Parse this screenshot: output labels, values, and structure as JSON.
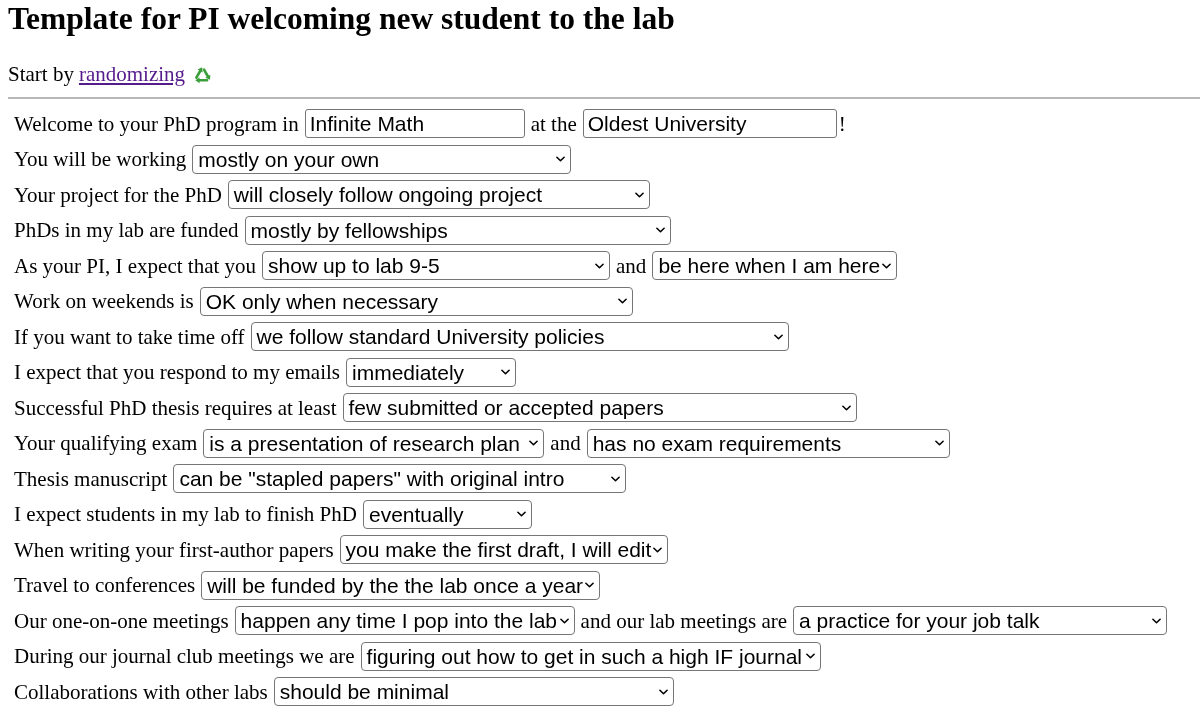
{
  "title": "Template for PI welcoming new student to the lab",
  "intro": {
    "text": "Start by",
    "link": "randomizing"
  },
  "rows": [
    {
      "parts": [
        {
          "kind": "text",
          "text": "Welcome to your PhD program in"
        },
        {
          "kind": "input",
          "value": "Infinite Math"
        },
        {
          "kind": "text",
          "text": "at the"
        },
        {
          "kind": "input",
          "value": "Oldest University",
          "suffix": "!"
        }
      ]
    },
    {
      "parts": [
        {
          "kind": "text",
          "text": "You will be working"
        },
        {
          "kind": "dropdown",
          "value": "mostly on your own"
        }
      ]
    },
    {
      "parts": [
        {
          "kind": "text",
          "text": "Your project for the PhD"
        },
        {
          "kind": "dropdown",
          "value": "will closely follow ongoing project"
        }
      ]
    },
    {
      "parts": [
        {
          "kind": "text",
          "text": "PhDs in my lab are funded"
        },
        {
          "kind": "dropdown",
          "value": "mostly by fellowships"
        }
      ]
    },
    {
      "parts": [
        {
          "kind": "text",
          "text": "As your PI, I expect that you"
        },
        {
          "kind": "dropdown",
          "value": "show up to lab 9-5"
        },
        {
          "kind": "text",
          "text": "and"
        },
        {
          "kind": "dropdown",
          "value": "be here when I am here"
        }
      ]
    },
    {
      "parts": [
        {
          "kind": "text",
          "text": "Work on weekends is"
        },
        {
          "kind": "dropdown",
          "value": "OK only when necessary"
        }
      ]
    },
    {
      "parts": [
        {
          "kind": "text",
          "text": "If you want to take time off"
        },
        {
          "kind": "dropdown",
          "value": "we follow standard University policies"
        }
      ]
    },
    {
      "parts": [
        {
          "kind": "text",
          "text": "I expect that you respond to my emails"
        },
        {
          "kind": "dropdown",
          "value": "immediately"
        }
      ]
    },
    {
      "parts": [
        {
          "kind": "text",
          "text": "Successful PhD thesis requires at least"
        },
        {
          "kind": "dropdown",
          "value": "few submitted or accepted papers"
        }
      ]
    },
    {
      "parts": [
        {
          "kind": "text",
          "text": "Your qualifying exam"
        },
        {
          "kind": "dropdown",
          "value": "is a presentation of research plan"
        },
        {
          "kind": "text",
          "text": "and"
        },
        {
          "kind": "dropdown",
          "value": "has no exam requirements"
        }
      ]
    },
    {
      "parts": [
        {
          "kind": "text",
          "text": "Thesis manuscript"
        },
        {
          "kind": "dropdown",
          "value": "can be \"stapled papers\" with original intro"
        }
      ]
    },
    {
      "parts": [
        {
          "kind": "text",
          "text": "I expect students in my lab to finish PhD"
        },
        {
          "kind": "dropdown",
          "value": "eventually"
        }
      ]
    },
    {
      "parts": [
        {
          "kind": "text",
          "text": "When writing your first-author papers"
        },
        {
          "kind": "dropdown",
          "value": "you make the first draft, I will edit"
        }
      ]
    },
    {
      "parts": [
        {
          "kind": "text",
          "text": "Travel to conferences"
        },
        {
          "kind": "dropdown",
          "value": "will be funded by the the lab once a year"
        }
      ]
    },
    {
      "parts": [
        {
          "kind": "text",
          "text": "Our one-on-one meetings"
        },
        {
          "kind": "dropdown",
          "value": "happen any time I pop into the lab"
        },
        {
          "kind": "text",
          "text": "and our lab meetings are"
        },
        {
          "kind": "dropdown",
          "value": "a practice for your job talk"
        }
      ]
    },
    {
      "parts": [
        {
          "kind": "text",
          "text": "During our journal club meetings we are"
        },
        {
          "kind": "dropdown",
          "value": "figuring out how to get in such a high IF journal"
        }
      ]
    },
    {
      "parts": [
        {
          "kind": "text",
          "text": "Collaborations with other labs"
        },
        {
          "kind": "dropdown",
          "value": "should be minimal"
        }
      ]
    }
  ]
}
